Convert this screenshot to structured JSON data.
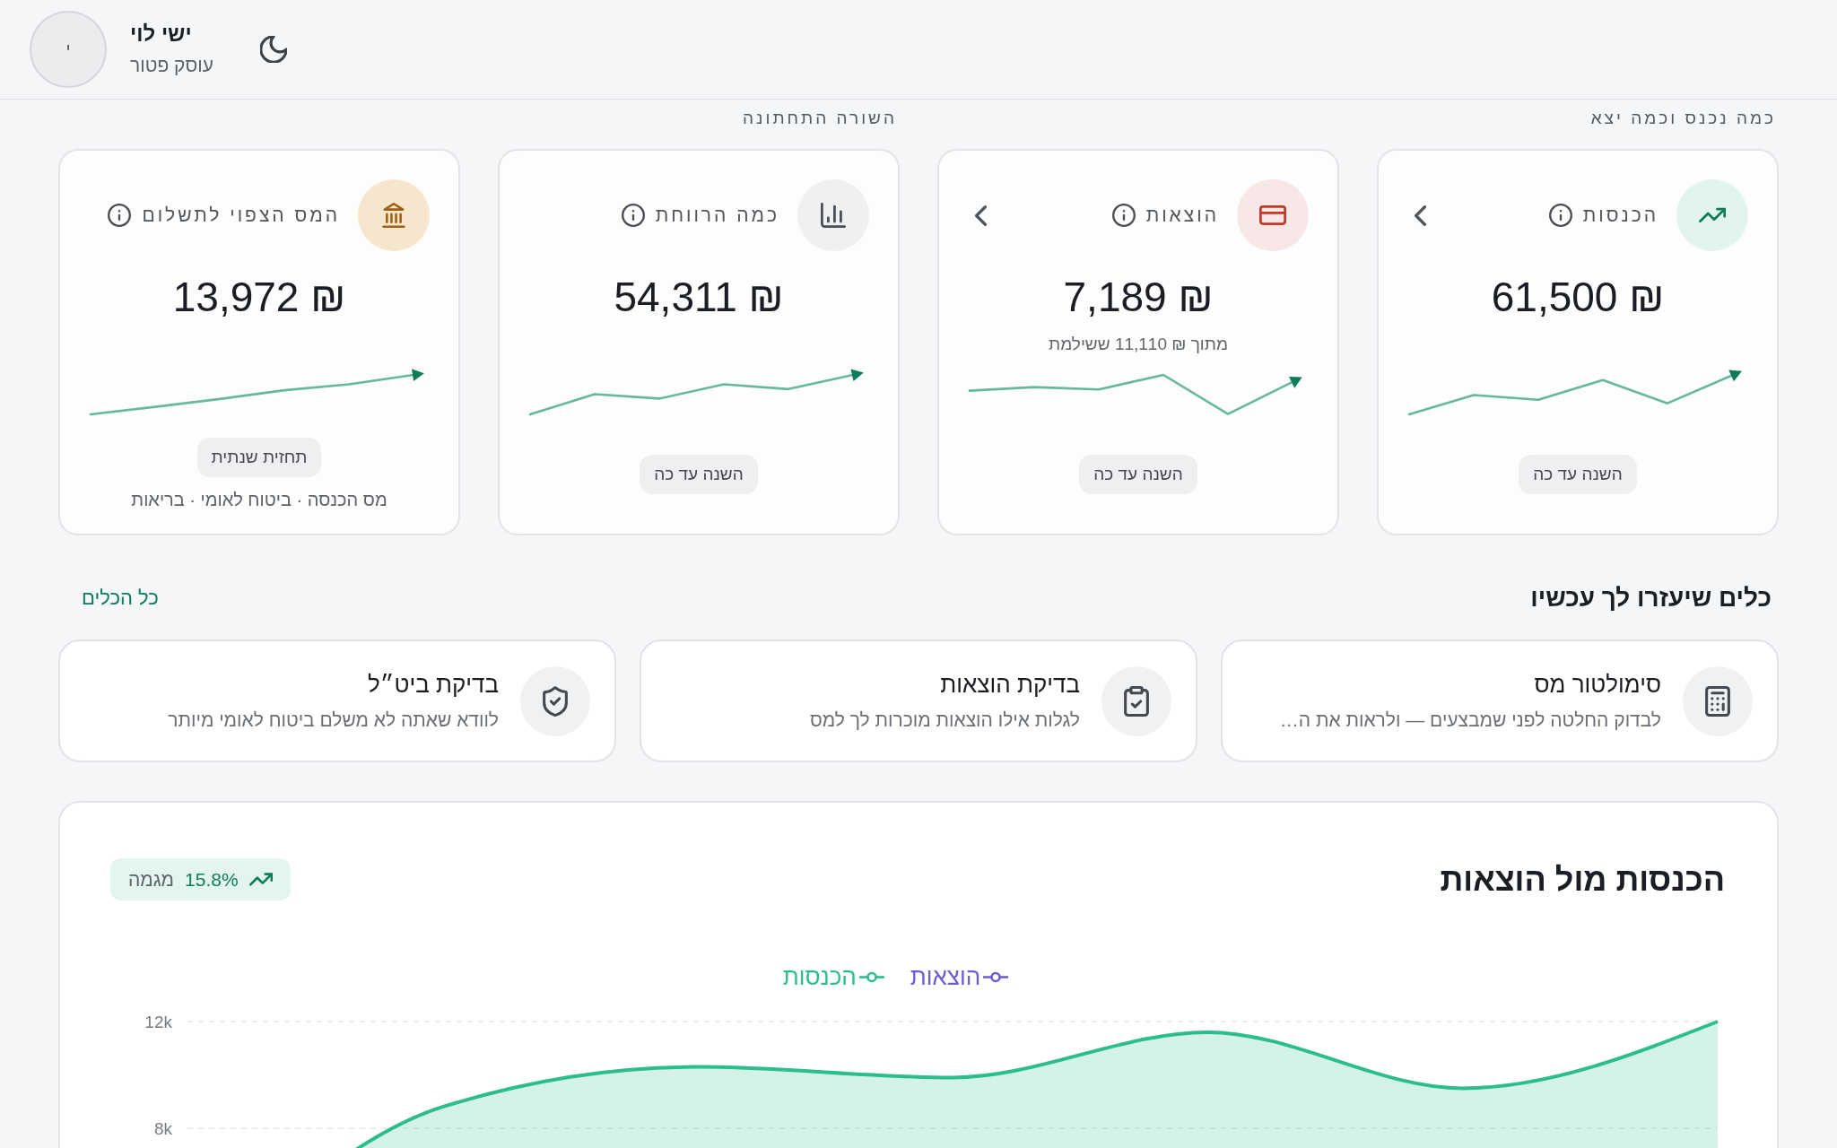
{
  "header": {
    "avatar_initial": "י",
    "name": "ישי לוי",
    "subtitle": "עוסק פטור"
  },
  "summary_groups": [
    {
      "label": "כמה נכנס וכמה יצא",
      "cards": [
        {
          "kind": "income",
          "label": "הכנסות",
          "value": "61,500 ₪",
          "has_details": true,
          "period": "השנה עד כה"
        },
        {
          "kind": "expenses",
          "label": "הוצאות",
          "value": "7,189 ₪",
          "note": "מתוך ₪ 11,110 ששילמת",
          "has_details": true,
          "period": "השנה עד כה"
        }
      ]
    },
    {
      "label": "השורה התחתונה",
      "cards": [
        {
          "kind": "profit",
          "label": "כמה הרווחת",
          "value": "54,311 ₪",
          "has_details": false,
          "period": "השנה עד כה"
        },
        {
          "kind": "tax",
          "label": "המס הצפוי לתשלום",
          "value": "13,972 ₪",
          "has_details": false,
          "period": "תחזית שנתית",
          "caption": "מס הכנסה · ביטוח לאומי · בריאות"
        }
      ]
    }
  ],
  "tools": {
    "title": "כלים שיעזרו לך עכשיו",
    "link": "כל הכלים",
    "items": [
      {
        "kind": "simulator",
        "title": "סימולטור מס",
        "description": "לבדוק החלטה לפני שמבצעים — ולראות את ה…"
      },
      {
        "kind": "expenses",
        "title": "בדיקת הוצאות",
        "description": "לגלות אילו הוצאות מוכרות לך למס"
      },
      {
        "kind": "insurance",
        "title": "בדיקת ביט״ל",
        "description": "לוודא שאתה לא משלם ביטוח לאומי מיותר"
      }
    ]
  },
  "chart_panel": {
    "title": "הכנסות מול הוצאות",
    "trend": {
      "value": "15.8%",
      "label": "מגמה"
    },
    "chart_data": {
      "type": "area",
      "series": [
        {
          "name": "הוצאות",
          "color": "#6c5dd3"
        },
        {
          "name": "הכנסות",
          "color": "#2bbd8e",
          "values": [
            2000,
            8800,
            10300,
            9900,
            11600,
            9500,
            12000
          ]
        }
      ],
      "ylim": [
        0,
        12000
      ],
      "yticks": [
        {
          "value": 8000,
          "label": "8k"
        },
        {
          "value": 12000,
          "label": "12k"
        }
      ]
    }
  }
}
